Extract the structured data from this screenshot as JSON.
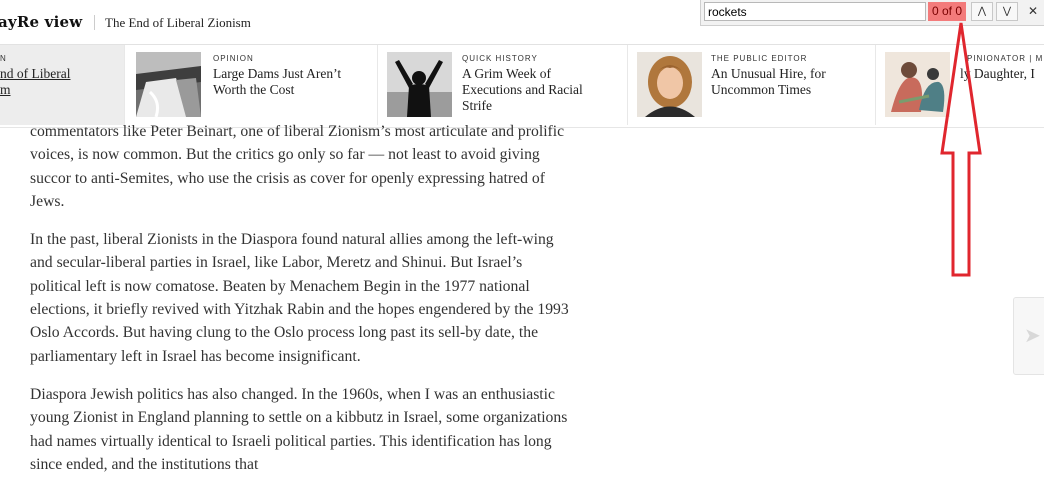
{
  "header": {
    "brand": "ayRe view",
    "article_title": "The End of Liberal Zionism"
  },
  "ribbon": {
    "items": [
      {
        "kicker": "N",
        "headline": "nd of Liberal\nm",
        "thumb": "none"
      },
      {
        "kicker": "OPINION",
        "headline": "Large Dams Just Aren’t\nWorth the Cost",
        "thumb": "dam-photo"
      },
      {
        "kicker": "QUICK HISTORY",
        "headline": "A Grim Week of\nExecutions and Racial\nStrife",
        "thumb": "silhouette-photo"
      },
      {
        "kicker": "THE PUBLIC EDITOR",
        "headline": "An Unusual Hire, for\nUncommon Times",
        "thumb": "portrait-photo"
      },
      {
        "kicker": "PINIONATOR | M",
        "headline": "ly Daughter, I",
        "thumb": "illustration"
      }
    ]
  },
  "findbar": {
    "query": "rockets",
    "count": "0 of 0",
    "prev_icon": "chevron-up-icon",
    "next_icon": "chevron-down-icon",
    "close_icon": "close-icon",
    "prev_glyph": "⋀",
    "next_glyph": "⋁",
    "close_glyph": "✕"
  },
  "article": {
    "paragraphs": [
      "commentators like Peter Beinart, one of liberal Zionism’s most articulate and prolific voices, is now common. But the critics go only so far — not least to avoid giving succor to anti-Semites, who use the crisis as cover for openly expressing hatred of Jews.",
      "In the past, liberal Zionists in the Diaspora found natural allies among the left-wing and secular-liberal parties in Israel, like Labor, Meretz and Shinui. But Israel’s political left is now comatose. Beaten by Menachem Begin in the 1977 national elections, it briefly revived with Yitzhak Rabin and the hopes engendered by the 1993 Oslo Accords. But having clung to the Oslo process long past its sell-by date, the parliamentary left in Israel has become insignificant.",
      "Diaspora Jewish politics has also changed. In the 1960s, when I was an enthusiastic young Zionist in England planning to settle on a kibbutz in Israel, some organizations had names virtually identical to Israeli political parties. This identification has long since ended, and the institutions that"
    ]
  },
  "next_arrow_glyph": "➤",
  "colors": {
    "find_no_match": "#f37b7b",
    "annotation": "#e0262e"
  }
}
